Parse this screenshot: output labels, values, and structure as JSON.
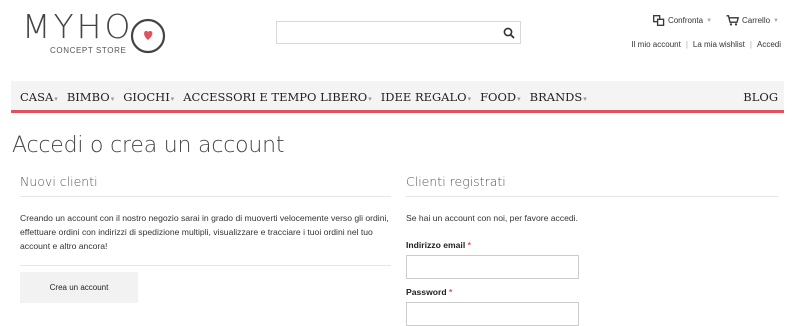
{
  "header": {
    "logo_text": "MYHO",
    "logo_subtitle": "CONCEPT STORE",
    "search_placeholder": "",
    "search_value": "",
    "compare_label": "Confronta",
    "cart_label": "Carrello",
    "account_links": [
      "Il mio account",
      "La mia wishlist",
      "Accedi"
    ]
  },
  "nav": {
    "items": [
      "CASA",
      "BIMBO",
      "GIOCHI",
      "ACCESSORI E TEMPO LIBERO",
      "IDEE REGALO",
      "FOOD",
      "BRANDS"
    ],
    "blog": "BLOG"
  },
  "page": {
    "title": "Accedi o crea un account"
  },
  "new_customers": {
    "title": "Nuovi clienti",
    "text": "Creando un account con il nostro negozio sarai in grado di muoverti velocemente verso gli ordini, effettuare ordini con indirizzi di spedizione multipli, visualizzare e tracciare i tuoi ordini nel tuo account e altro ancora!",
    "button": "Crea un account"
  },
  "registered": {
    "title": "Clienti registrati",
    "text": "Se hai un account con noi, per favore accedi.",
    "email_label": "Indirizzo email",
    "password_label": "Password",
    "required_mark": "*",
    "email_value": "",
    "password_value": ""
  },
  "colors": {
    "accent": "#e2505c",
    "nav_bg": "#f4f4f4",
    "button_bg": "#f2f2f2"
  },
  "icons": {
    "search": "search-icon",
    "compare": "compare-icon",
    "cart": "cart-icon",
    "logo_heart": "heart-icon"
  }
}
